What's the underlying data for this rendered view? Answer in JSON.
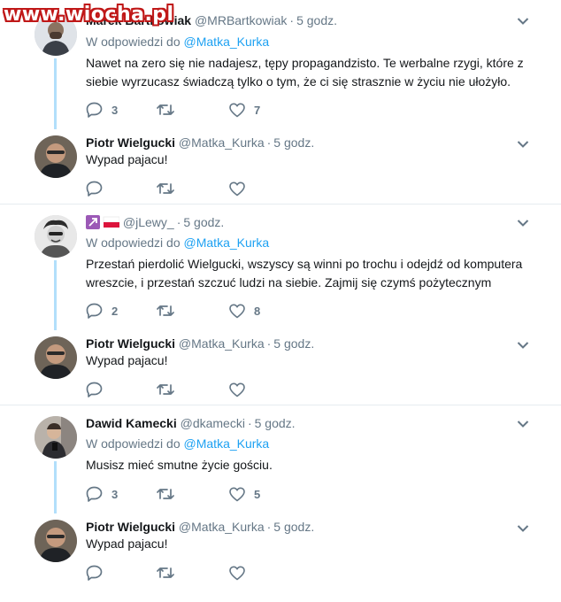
{
  "watermark": "www.wiocha.pl",
  "threads": [
    {
      "parent": {
        "name": "Marek Bartkowiak",
        "handle": "@MRBartkowiak",
        "time": "5 godz.",
        "reply_prefix": "W odpowiedzi do",
        "reply_handle": "@Matka_Kurka",
        "text": "Nawet na zero się nie nadajesz, tępy propagandzisto. Te werbalne rzygi, które z siebie wyrzucasz świadczą tylko o tym, że ci się strasznie w życiu nie ułożyło.",
        "replies": "3",
        "retweets": "",
        "likes": "7"
      },
      "reply": {
        "name": "Piotr Wielgucki",
        "handle": "@Matka_Kurka",
        "time": "5 godz.",
        "text": "Wypad pajacu!",
        "replies": "",
        "retweets": "",
        "likes": ""
      }
    },
    {
      "parent": {
        "name": "",
        "handle": "@jLewy_",
        "time": "5 godz.",
        "reply_prefix": "W odpowiedzi do",
        "reply_handle": "@Matka_Kurka",
        "text": "Przestań pierdolić Wielgucki, wszyscy są winni po trochu i odejdź od komputera wreszcie, i przestań szczuć ludzi na siebie. Zajmij się czymś pożytecznym",
        "replies": "2",
        "retweets": "",
        "likes": "8"
      },
      "reply": {
        "name": "Piotr Wielgucki",
        "handle": "@Matka_Kurka",
        "time": "5 godz.",
        "text": "Wypad pajacu!",
        "replies": "",
        "retweets": "",
        "likes": ""
      }
    },
    {
      "parent": {
        "name": "Dawid Kamecki",
        "handle": "@dkamecki",
        "time": "5 godz.",
        "reply_prefix": "W odpowiedzi do",
        "reply_handle": "@Matka_Kurka",
        "text": "Musisz mieć smutne życie gościu.",
        "replies": "3",
        "retweets": "",
        "likes": "5"
      },
      "reply": {
        "name": "Piotr Wielgucki",
        "handle": "@Matka_Kurka",
        "time": "5 godz.",
        "text": "Wypad pajacu!",
        "replies": "",
        "retweets": "",
        "likes": ""
      }
    }
  ],
  "icons": {
    "reply": "reply-icon",
    "retweet": "retweet-icon",
    "like": "heart-icon",
    "more": "chevron-down-icon"
  },
  "colors": {
    "link": "#1da1f2",
    "secondary": "#657786",
    "connector": "#b2dffb",
    "divider": "#e6ecf0"
  }
}
